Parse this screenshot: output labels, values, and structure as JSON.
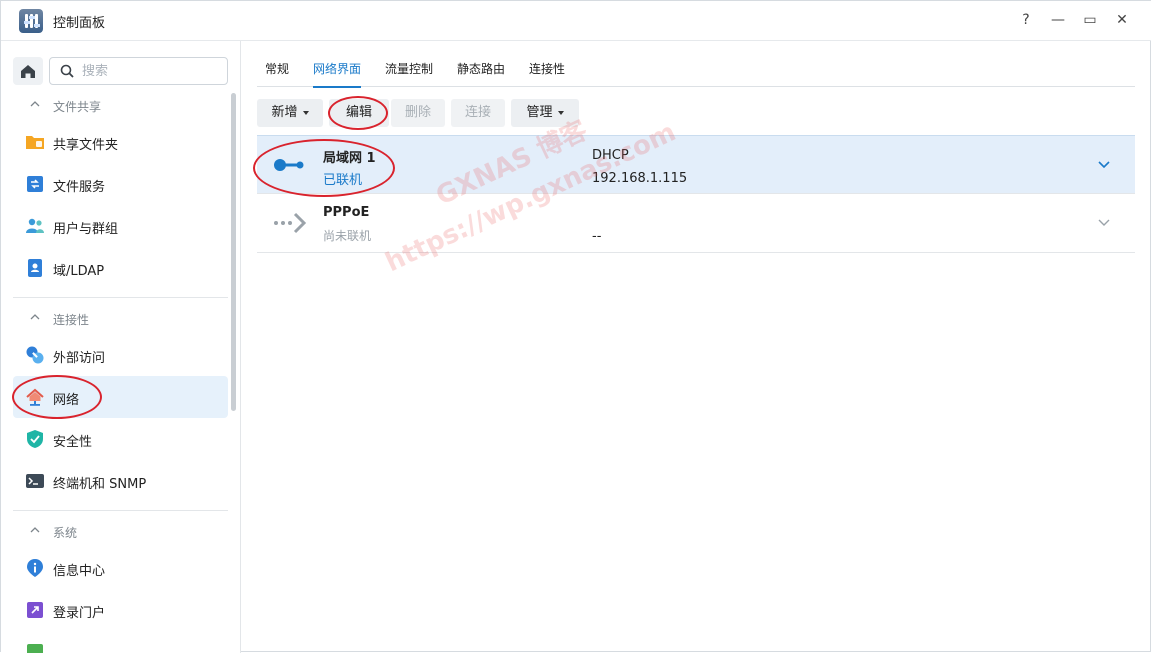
{
  "window": {
    "title": "控制面板",
    "controls": {
      "help": "?",
      "minimize": "—",
      "maximize": "▭",
      "close": "✕"
    }
  },
  "sidebar": {
    "search": {
      "placeholder": "搜索",
      "value": ""
    },
    "sections": [
      {
        "label": "文件共享",
        "items": [
          {
            "label": "共享文件夹",
            "icon": "folder-icon"
          },
          {
            "label": "文件服务",
            "icon": "file-services-icon"
          },
          {
            "label": "用户与群组",
            "icon": "users-icon"
          },
          {
            "label": "域/LDAP",
            "icon": "ldap-icon"
          }
        ]
      },
      {
        "label": "连接性",
        "items": [
          {
            "label": "外部访问",
            "icon": "external-access-icon"
          },
          {
            "label": "网络",
            "icon": "network-icon",
            "active": true
          },
          {
            "label": "安全性",
            "icon": "shield-icon"
          },
          {
            "label": "终端机和 SNMP",
            "icon": "terminal-icon"
          }
        ]
      },
      {
        "label": "系统",
        "items": [
          {
            "label": "信息中心",
            "icon": "info-icon"
          },
          {
            "label": "登录门户",
            "icon": "login-portal-icon"
          }
        ]
      }
    ]
  },
  "main": {
    "tabs": [
      {
        "label": "常规"
      },
      {
        "label": "网络界面",
        "active": true
      },
      {
        "label": "流量控制"
      },
      {
        "label": "静态路由"
      },
      {
        "label": "连接性"
      }
    ],
    "toolbar": {
      "create": "新增",
      "edit": "编辑",
      "delete": "删除",
      "connect": "连接",
      "manage": "管理"
    },
    "interfaces": [
      {
        "name": "局域网 1",
        "status": "已联机",
        "mode": "DHCP",
        "ip": "192.168.1.115",
        "connected": true
      },
      {
        "name": "PPPoE",
        "status": "尚未联机",
        "mode": "",
        "ip": "--",
        "connected": false
      }
    ]
  },
  "watermark": {
    "line1": "GXNAS 博客",
    "line2": "https://wp.gxnas.com"
  },
  "colors": {
    "accent": "#1a7ac9",
    "annotation": "#d9232d",
    "selected_row": "#e3eefa"
  }
}
